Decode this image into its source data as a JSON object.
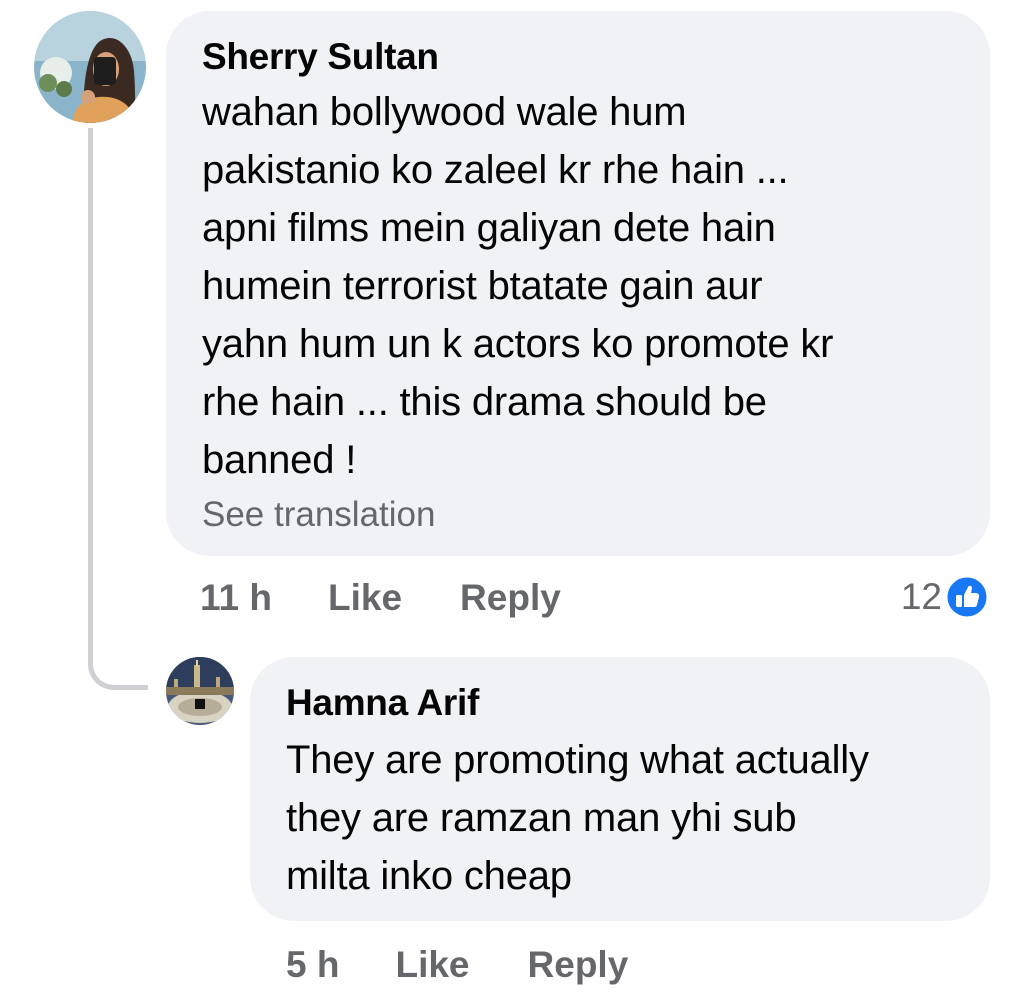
{
  "comment": {
    "author": "Sherry Sultan",
    "text": "wahan bollywood wale hum\npakistanio ko zaleel kr rhe hain ...\napni films mein galiyan dete hain\nhumein terrorist btatate gain aur\nyahn hum un k actors ko promote kr\nrhe hain ... this drama should be\nbanned !",
    "see_translation": "See translation",
    "time": "11 h",
    "like_label": "Like",
    "reply_label": "Reply",
    "reaction_count": "12",
    "reaction_icon": "like-reaction-icon"
  },
  "reply": {
    "author": "Hamna Arif",
    "text": "They are promoting what actually\nthey are ramzan man yhi sub\nmilta inko cheap",
    "time": "5 h",
    "like_label": "Like",
    "reply_label": "Reply"
  },
  "colors": {
    "bubble": "#f0f2f5",
    "secondary_text": "#65676b",
    "like_blue": "#1877f2",
    "thread_line": "#ced0d4"
  }
}
